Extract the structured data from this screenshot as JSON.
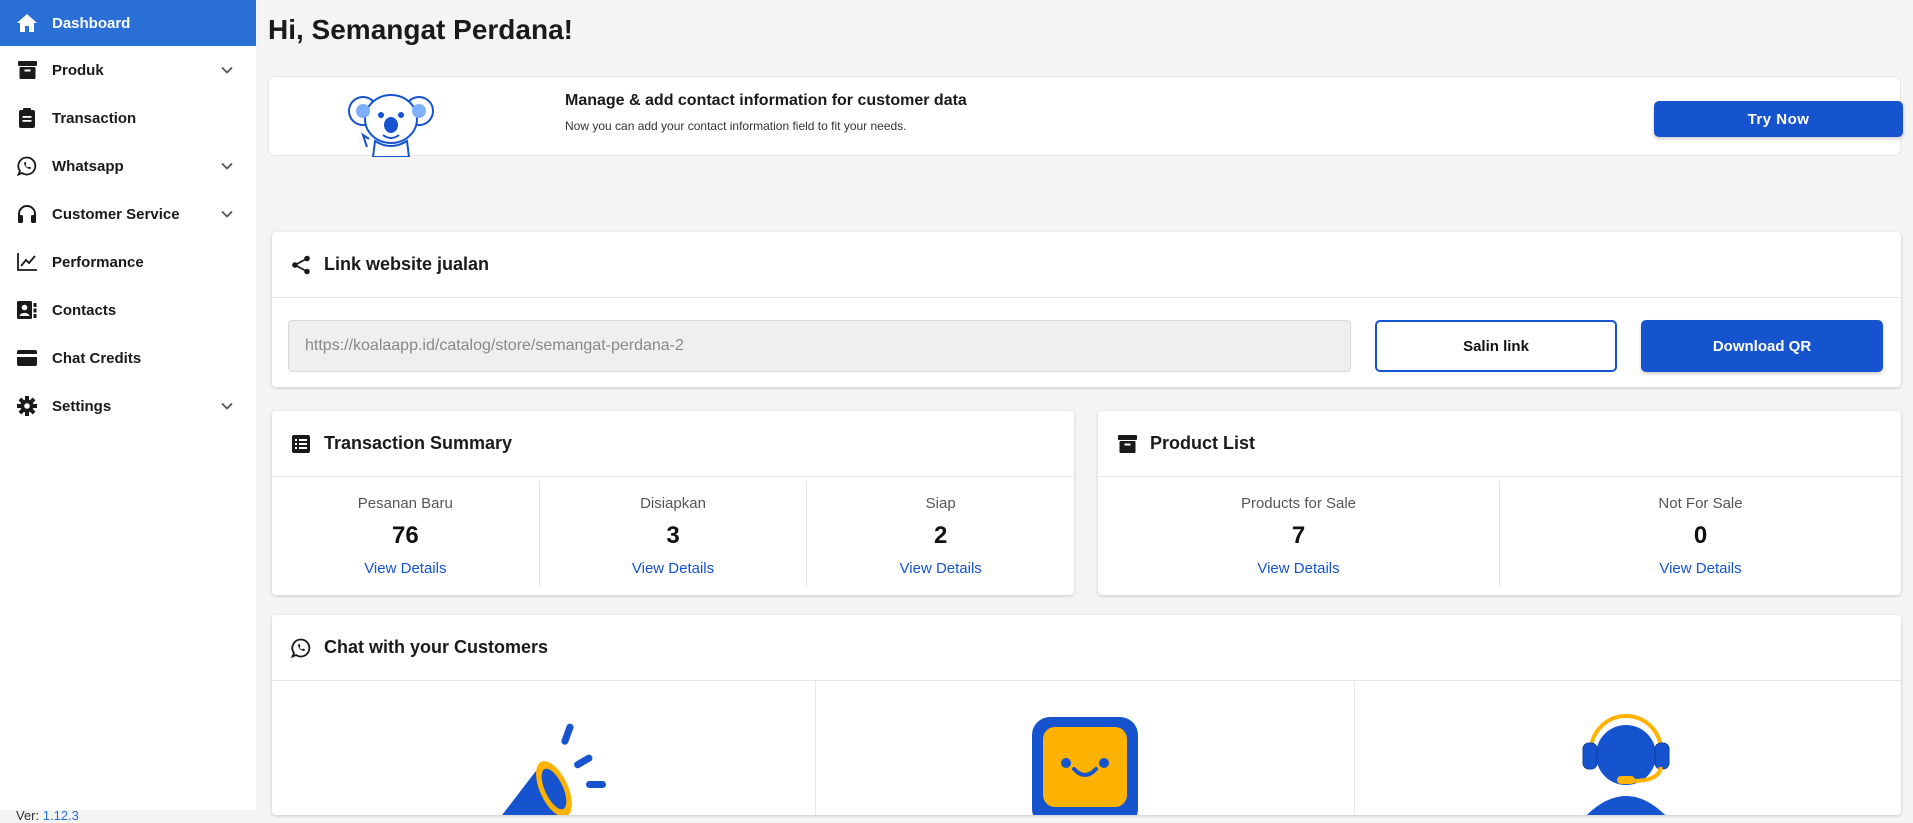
{
  "sidebar": {
    "items": [
      {
        "label": "Dashboard",
        "icon": "home-icon",
        "active": true,
        "expandable": false
      },
      {
        "label": "Produk",
        "icon": "archive-icon",
        "expandable": true
      },
      {
        "label": "Transaction",
        "icon": "clipboard-icon",
        "expandable": false
      },
      {
        "label": "Whatsapp",
        "icon": "whatsapp-icon",
        "expandable": true
      },
      {
        "label": "Customer Service",
        "icon": "headphones-icon",
        "expandable": true
      },
      {
        "label": "Performance",
        "icon": "chart-line-icon",
        "expandable": false
      },
      {
        "label": "Contacts",
        "icon": "contact-card-icon",
        "expandable": false
      },
      {
        "label": "Chat Credits",
        "icon": "credit-card-icon",
        "expandable": false
      },
      {
        "label": "Settings",
        "icon": "gear-icon",
        "expandable": true
      }
    ],
    "version_label": "Ver:",
    "version_value": "1.12.3"
  },
  "main": {
    "greeting": "Hi, Semangat Perdana!",
    "banner": {
      "title": "Manage & add contact information for customer data",
      "subtitle": "Now you can add your contact information field to fit your needs.",
      "button": "Try Now",
      "illustration": "koala-mascot"
    },
    "link_card": {
      "title": "Link website jualan",
      "url": "https://koalaapp.id/catalog/store/semangat-perdana-2",
      "copy_button": "Salin link",
      "download_button": "Download QR"
    },
    "transaction_summary": {
      "title": "Transaction Summary",
      "stats": [
        {
          "label": "Pesanan Baru",
          "value": "76",
          "link": "View Details"
        },
        {
          "label": "Disiapkan",
          "value": "3",
          "link": "View Details"
        },
        {
          "label": "Siap",
          "value": "2",
          "link": "View Details"
        }
      ]
    },
    "product_list": {
      "title": "Product List",
      "stats": [
        {
          "label": "Products for Sale",
          "value": "7",
          "link": "View Details"
        },
        {
          "label": "Not For Sale",
          "value": "0",
          "link": "View Details"
        }
      ]
    },
    "chat_card": {
      "title": "Chat with your Customers",
      "illustrations": [
        "megaphone-illustration",
        "chatbot-illustration",
        "agent-headset-illustration"
      ]
    }
  },
  "colors": {
    "primary": "#1553cf",
    "active_nav": "#2a6fd6",
    "background": "#f4f4f4",
    "accent_orange": "#ffb300"
  }
}
